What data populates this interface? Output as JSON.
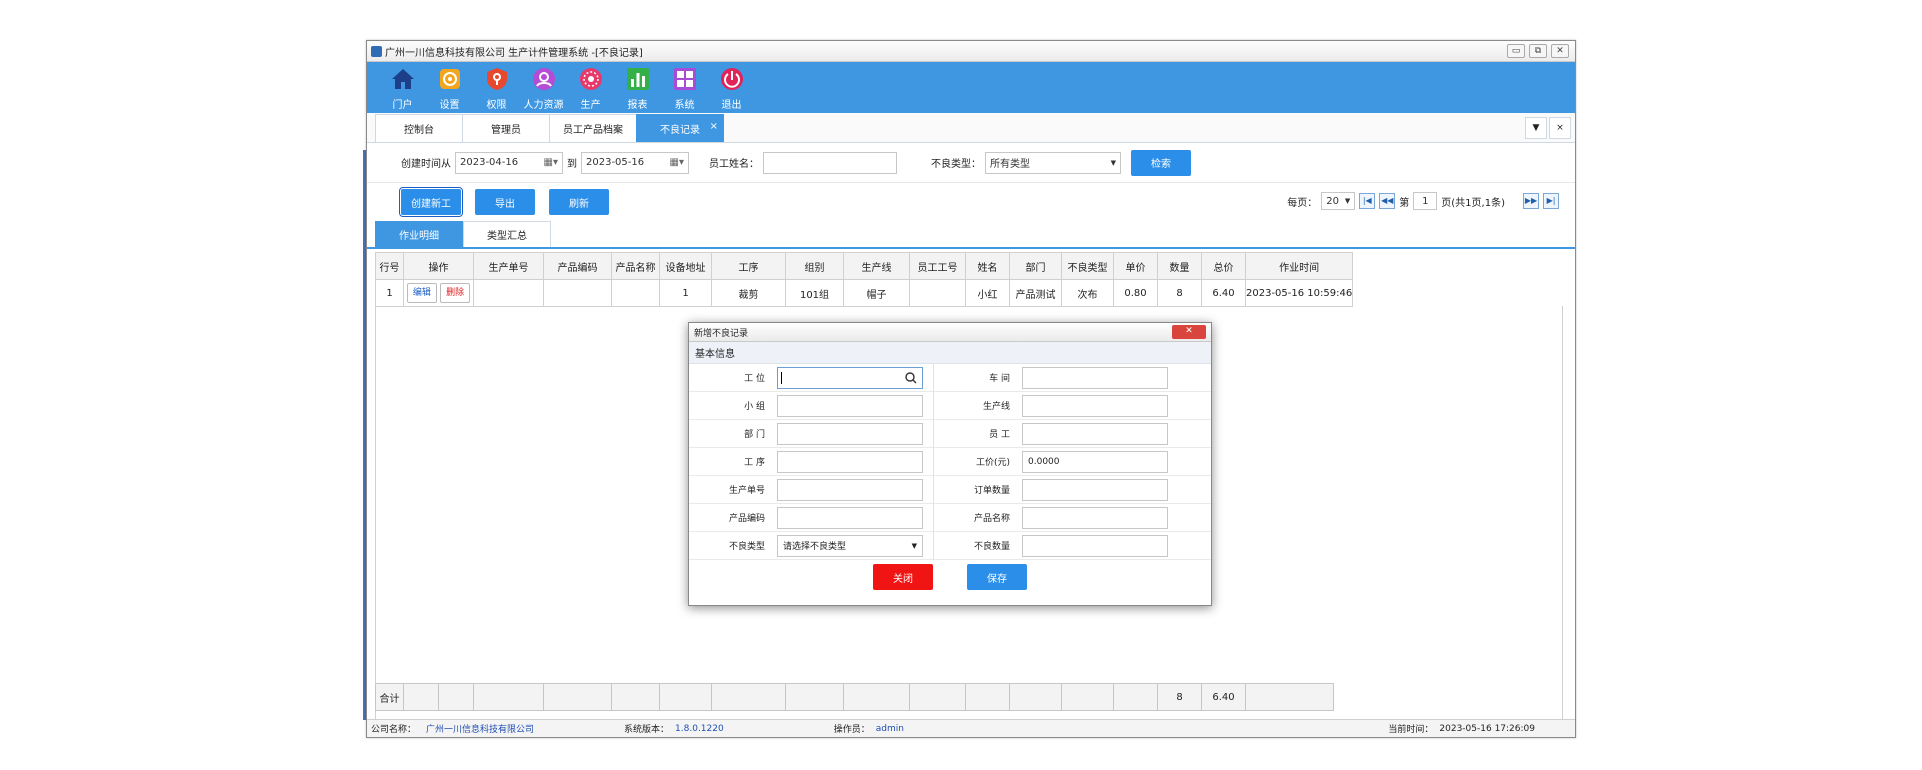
{
  "window": {
    "title": "广州一川信息科技有限公司 生产计件管理系统 -[不良记录]",
    "controls": [
      "▭",
      "⧉",
      "✕"
    ]
  },
  "toolbar": {
    "items": [
      {
        "label": "门户",
        "icon": "home-icon",
        "color": "#1d3f8a"
      },
      {
        "label": "设置",
        "icon": "gear-icon",
        "color": "#f2a51d"
      },
      {
        "label": "权限",
        "icon": "shield-icon",
        "color": "#e8482e"
      },
      {
        "label": "人力资源",
        "icon": "person-icon",
        "color": "#b64bd6"
      },
      {
        "label": "生产",
        "icon": "production-icon",
        "color": "#e83a6a"
      },
      {
        "label": "报表",
        "icon": "chart-icon",
        "color": "#34b04a"
      },
      {
        "label": "系统",
        "icon": "system-icon",
        "color": "#a84bd6"
      },
      {
        "label": "退出",
        "icon": "power-icon",
        "color": "#e0245a"
      }
    ]
  },
  "tabs": {
    "items": [
      "控制台",
      "管理员",
      "员工产品档案",
      "不良记录"
    ],
    "active_index": 3,
    "close": "×",
    "ctrl_down": "▼",
    "ctrl_close": "×"
  },
  "filter": {
    "date_label": "创建时间从",
    "date_from": "2023-04-16",
    "to_label": "到",
    "date_to": "2023-05-16",
    "calendar_glyph": "▦▾",
    "employee_label": "员工姓名：",
    "employee_value": "",
    "type_label": "不良类型：",
    "type_value": "所有类型",
    "search_label": "检索"
  },
  "actions": {
    "create": "创建新工",
    "export": "导出",
    "refresh": "刷新"
  },
  "pager": {
    "per_page_label": "每页：",
    "per_page": "20",
    "page_prefix": "第",
    "page": "1",
    "page_suffix": "页(共1页,1条)",
    "first": "|◀",
    "prev": "◀◀",
    "next": "▶▶",
    "last": "▶|"
  },
  "subtabs": {
    "items": [
      "作业明细",
      "类型汇总"
    ],
    "active_index": 0
  },
  "table": {
    "headers": [
      "行号",
      "操作",
      "生产单号",
      "产品编码",
      "产品名称",
      "设备地址",
      "工序",
      "组别",
      "生产线",
      "员工工号",
      "姓名",
      "部门",
      "不良类型",
      "单价",
      "数量",
      "总价",
      "作业时间"
    ],
    "rows": [
      {
        "row_no": "1",
        "edit": "编辑",
        "delete": "删除",
        "order_no": "",
        "product_code": "",
        "product_name": "",
        "device": "1",
        "process": "裁剪",
        "group": "101组",
        "line": "帽子",
        "emp_no": "",
        "name": "小红",
        "dept": "产品测试",
        "type": "次布",
        "price": "0.80",
        "qty": "8",
        "total": "6.40",
        "time": "2023-05-16 10:59:46"
      }
    ],
    "totals": {
      "label": "合计",
      "qty": "8",
      "total": "6.40"
    }
  },
  "statusbar": {
    "company_label": "公司名称：",
    "company": "广州一川信息科技有限公司",
    "version_label": "系统版本：",
    "version": "1.8.0.1220",
    "operator_label": "操作员：",
    "operator": "admin",
    "time_label": "当前时间：",
    "time": "2023-05-16 17:26:09"
  },
  "dialog": {
    "title": "新增不良记录",
    "close": "✕",
    "section": "基本信息",
    "fields": [
      {
        "left_label": "工    位",
        "left_value": "",
        "right_label": "车    间",
        "right_value": ""
      },
      {
        "left_label": "小    组",
        "left_value": "",
        "right_label": "生产线",
        "right_value": ""
      },
      {
        "left_label": "部    门",
        "left_value": "",
        "right_label": "员    工",
        "right_value": ""
      },
      {
        "left_label": "工    序",
        "left_value": "",
        "right_label": "工价(元)",
        "right_value": "0.0000"
      },
      {
        "left_label": "生产单号",
        "left_value": "",
        "right_label": "订单数量",
        "right_value": ""
      },
      {
        "left_label": "产品编码",
        "left_value": "",
        "right_label": "产品名称",
        "right_value": ""
      },
      {
        "left_label": "不良类型",
        "left_value": "请选择不良类型",
        "right_label": "不良数量",
        "right_value": ""
      }
    ],
    "close_label": "关闭",
    "save_label": "保存",
    "colors": {
      "close": "#f11414",
      "save": "#2b8ee8"
    }
  }
}
